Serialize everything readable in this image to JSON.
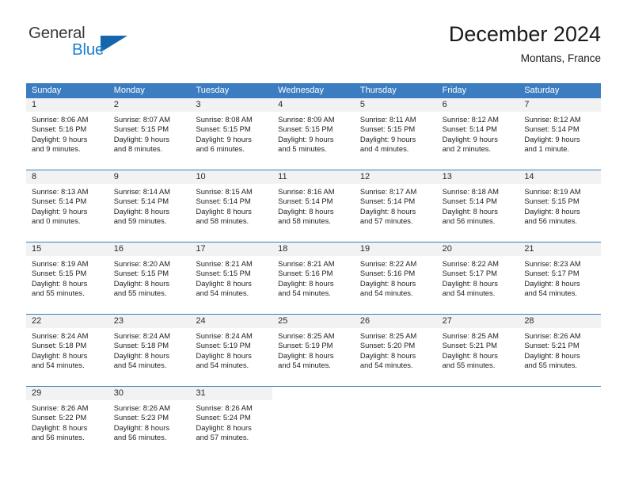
{
  "brand": {
    "name_top": "General",
    "name_bottom": "Blue",
    "color_dark": "#3a3a3a",
    "color_blue": "#1c7fd1",
    "triangle_color": "#1565ac"
  },
  "header": {
    "title": "December 2024",
    "subtitle": "Montans, France"
  },
  "theme": {
    "header_row_bg": "#3b7dc0",
    "header_row_text": "#ffffff",
    "day_number_bg": "#f2f2f2",
    "week_divider": "#3b7dc0",
    "body_text": "#222222"
  },
  "weekdays": [
    "Sunday",
    "Monday",
    "Tuesday",
    "Wednesday",
    "Thursday",
    "Friday",
    "Saturday"
  ],
  "labels": {
    "sunrise_prefix": "Sunrise:",
    "sunset_prefix": "Sunset:",
    "daylight_prefix": "Daylight:"
  },
  "weeks": [
    {
      "days": [
        {
          "num": "1",
          "sunrise": "Sunrise: 8:06 AM",
          "sunset": "Sunset: 5:16 PM",
          "daylight1": "Daylight: 9 hours",
          "daylight2": "and 9 minutes."
        },
        {
          "num": "2",
          "sunrise": "Sunrise: 8:07 AM",
          "sunset": "Sunset: 5:15 PM",
          "daylight1": "Daylight: 9 hours",
          "daylight2": "and 8 minutes."
        },
        {
          "num": "3",
          "sunrise": "Sunrise: 8:08 AM",
          "sunset": "Sunset: 5:15 PM",
          "daylight1": "Daylight: 9 hours",
          "daylight2": "and 6 minutes."
        },
        {
          "num": "4",
          "sunrise": "Sunrise: 8:09 AM",
          "sunset": "Sunset: 5:15 PM",
          "daylight1": "Daylight: 9 hours",
          "daylight2": "and 5 minutes."
        },
        {
          "num": "5",
          "sunrise": "Sunrise: 8:11 AM",
          "sunset": "Sunset: 5:15 PM",
          "daylight1": "Daylight: 9 hours",
          "daylight2": "and 4 minutes."
        },
        {
          "num": "6",
          "sunrise": "Sunrise: 8:12 AM",
          "sunset": "Sunset: 5:14 PM",
          "daylight1": "Daylight: 9 hours",
          "daylight2": "and 2 minutes."
        },
        {
          "num": "7",
          "sunrise": "Sunrise: 8:12 AM",
          "sunset": "Sunset: 5:14 PM",
          "daylight1": "Daylight: 9 hours",
          "daylight2": "and 1 minute."
        }
      ]
    },
    {
      "days": [
        {
          "num": "8",
          "sunrise": "Sunrise: 8:13 AM",
          "sunset": "Sunset: 5:14 PM",
          "daylight1": "Daylight: 9 hours",
          "daylight2": "and 0 minutes."
        },
        {
          "num": "9",
          "sunrise": "Sunrise: 8:14 AM",
          "sunset": "Sunset: 5:14 PM",
          "daylight1": "Daylight: 8 hours",
          "daylight2": "and 59 minutes."
        },
        {
          "num": "10",
          "sunrise": "Sunrise: 8:15 AM",
          "sunset": "Sunset: 5:14 PM",
          "daylight1": "Daylight: 8 hours",
          "daylight2": "and 58 minutes."
        },
        {
          "num": "11",
          "sunrise": "Sunrise: 8:16 AM",
          "sunset": "Sunset: 5:14 PM",
          "daylight1": "Daylight: 8 hours",
          "daylight2": "and 58 minutes."
        },
        {
          "num": "12",
          "sunrise": "Sunrise: 8:17 AM",
          "sunset": "Sunset: 5:14 PM",
          "daylight1": "Daylight: 8 hours",
          "daylight2": "and 57 minutes."
        },
        {
          "num": "13",
          "sunrise": "Sunrise: 8:18 AM",
          "sunset": "Sunset: 5:14 PM",
          "daylight1": "Daylight: 8 hours",
          "daylight2": "and 56 minutes."
        },
        {
          "num": "14",
          "sunrise": "Sunrise: 8:19 AM",
          "sunset": "Sunset: 5:15 PM",
          "daylight1": "Daylight: 8 hours",
          "daylight2": "and 56 minutes."
        }
      ]
    },
    {
      "days": [
        {
          "num": "15",
          "sunrise": "Sunrise: 8:19 AM",
          "sunset": "Sunset: 5:15 PM",
          "daylight1": "Daylight: 8 hours",
          "daylight2": "and 55 minutes."
        },
        {
          "num": "16",
          "sunrise": "Sunrise: 8:20 AM",
          "sunset": "Sunset: 5:15 PM",
          "daylight1": "Daylight: 8 hours",
          "daylight2": "and 55 minutes."
        },
        {
          "num": "17",
          "sunrise": "Sunrise: 8:21 AM",
          "sunset": "Sunset: 5:15 PM",
          "daylight1": "Daylight: 8 hours",
          "daylight2": "and 54 minutes."
        },
        {
          "num": "18",
          "sunrise": "Sunrise: 8:21 AM",
          "sunset": "Sunset: 5:16 PM",
          "daylight1": "Daylight: 8 hours",
          "daylight2": "and 54 minutes."
        },
        {
          "num": "19",
          "sunrise": "Sunrise: 8:22 AM",
          "sunset": "Sunset: 5:16 PM",
          "daylight1": "Daylight: 8 hours",
          "daylight2": "and 54 minutes."
        },
        {
          "num": "20",
          "sunrise": "Sunrise: 8:22 AM",
          "sunset": "Sunset: 5:17 PM",
          "daylight1": "Daylight: 8 hours",
          "daylight2": "and 54 minutes."
        },
        {
          "num": "21",
          "sunrise": "Sunrise: 8:23 AM",
          "sunset": "Sunset: 5:17 PM",
          "daylight1": "Daylight: 8 hours",
          "daylight2": "and 54 minutes."
        }
      ]
    },
    {
      "days": [
        {
          "num": "22",
          "sunrise": "Sunrise: 8:24 AM",
          "sunset": "Sunset: 5:18 PM",
          "daylight1": "Daylight: 8 hours",
          "daylight2": "and 54 minutes."
        },
        {
          "num": "23",
          "sunrise": "Sunrise: 8:24 AM",
          "sunset": "Sunset: 5:18 PM",
          "daylight1": "Daylight: 8 hours",
          "daylight2": "and 54 minutes."
        },
        {
          "num": "24",
          "sunrise": "Sunrise: 8:24 AM",
          "sunset": "Sunset: 5:19 PM",
          "daylight1": "Daylight: 8 hours",
          "daylight2": "and 54 minutes."
        },
        {
          "num": "25",
          "sunrise": "Sunrise: 8:25 AM",
          "sunset": "Sunset: 5:19 PM",
          "daylight1": "Daylight: 8 hours",
          "daylight2": "and 54 minutes."
        },
        {
          "num": "26",
          "sunrise": "Sunrise: 8:25 AM",
          "sunset": "Sunset: 5:20 PM",
          "daylight1": "Daylight: 8 hours",
          "daylight2": "and 54 minutes."
        },
        {
          "num": "27",
          "sunrise": "Sunrise: 8:25 AM",
          "sunset": "Sunset: 5:21 PM",
          "daylight1": "Daylight: 8 hours",
          "daylight2": "and 55 minutes."
        },
        {
          "num": "28",
          "sunrise": "Sunrise: 8:26 AM",
          "sunset": "Sunset: 5:21 PM",
          "daylight1": "Daylight: 8 hours",
          "daylight2": "and 55 minutes."
        }
      ]
    },
    {
      "days": [
        {
          "num": "29",
          "sunrise": "Sunrise: 8:26 AM",
          "sunset": "Sunset: 5:22 PM",
          "daylight1": "Daylight: 8 hours",
          "daylight2": "and 56 minutes."
        },
        {
          "num": "30",
          "sunrise": "Sunrise: 8:26 AM",
          "sunset": "Sunset: 5:23 PM",
          "daylight1": "Daylight: 8 hours",
          "daylight2": "and 56 minutes."
        },
        {
          "num": "31",
          "sunrise": "Sunrise: 8:26 AM",
          "sunset": "Sunset: 5:24 PM",
          "daylight1": "Daylight: 8 hours",
          "daylight2": "and 57 minutes."
        },
        {
          "num": "",
          "sunrise": "",
          "sunset": "",
          "daylight1": "",
          "daylight2": ""
        },
        {
          "num": "",
          "sunrise": "",
          "sunset": "",
          "daylight1": "",
          "daylight2": ""
        },
        {
          "num": "",
          "sunrise": "",
          "sunset": "",
          "daylight1": "",
          "daylight2": ""
        },
        {
          "num": "",
          "sunrise": "",
          "sunset": "",
          "daylight1": "",
          "daylight2": ""
        }
      ]
    }
  ]
}
